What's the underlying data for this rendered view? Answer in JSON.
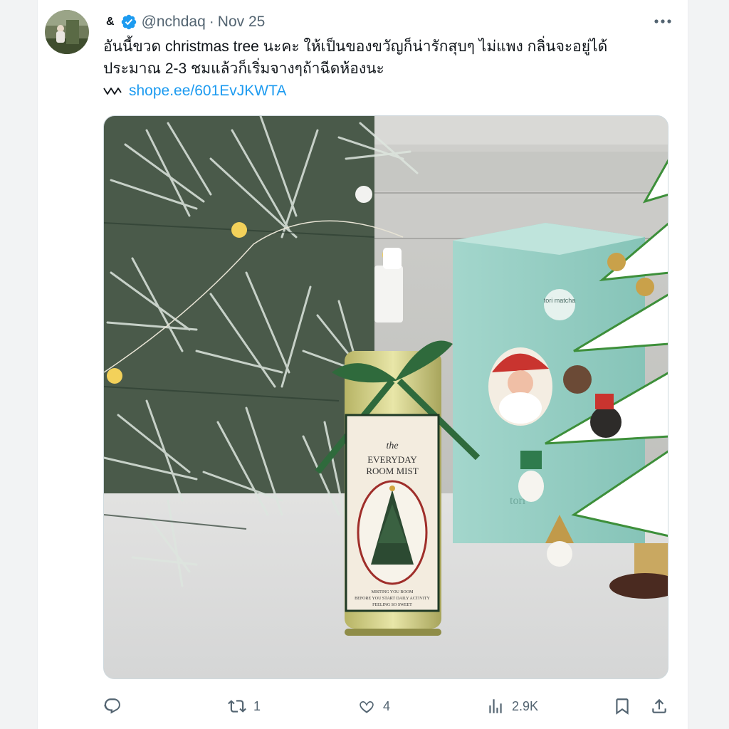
{
  "tweet": {
    "display_name": "&",
    "handle": "@nchdaq",
    "separator": "·",
    "date": "Nov 25",
    "text_line1": "อันนี้ขวด christmas tree นะคะ ให้เป็นของขวัญก็น่ารักสุบๆ ไม่แพง กลิ่นจะอยู่ได้",
    "text_line2": "ประมาณ 2-3 ชมแล้วก็เริ่มจางๆถ้าฉีดห้องนะ",
    "link_text": "shope.ee/601EvJKWTA"
  },
  "media": {
    "label_small": "the",
    "label_line1": "EVERYDAY",
    "label_line2": "ROOM MIST",
    "label_small_1": "MISTING YOU ROOM",
    "label_small_2": "BEFORE YOU START DAILY ACTIVITY",
    "label_small_3": "FEELING SO SWEET",
    "box_sticker": "tori matcha",
    "box_logo": "tori"
  },
  "actions": {
    "reply_count": "",
    "retweet_count": "1",
    "like_count": "4",
    "views_count": "2.9K"
  },
  "colors": {
    "link": "#1d9bf0",
    "verified": "#1d9bf0",
    "text": "#0f1419",
    "muted": "#536471"
  },
  "icons": [
    "verified-badge-icon",
    "more-icon",
    "link-icon",
    "reply-icon",
    "retweet-icon",
    "like-icon",
    "views-icon",
    "bookmark-icon",
    "share-icon"
  ]
}
